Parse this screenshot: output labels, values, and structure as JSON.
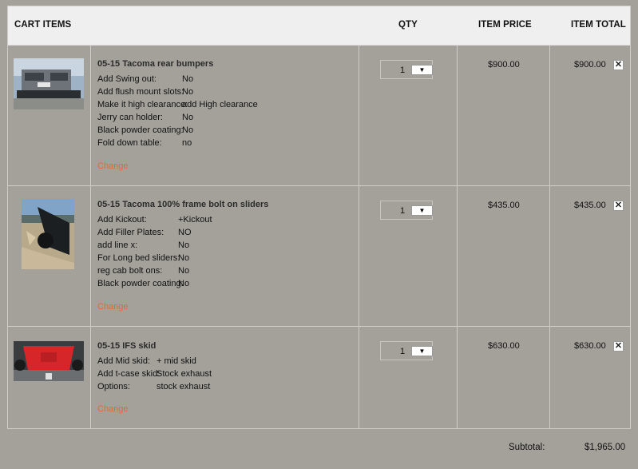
{
  "header": {
    "items_label": "CART ITEMS",
    "qty_label": "QTY",
    "price_label": "ITEM PRICE",
    "total_label": "ITEM TOTAL"
  },
  "items": [
    {
      "name": "05-15 Tacoma rear bumpers",
      "options": [
        {
          "key": "Add Swing out:",
          "value": "No"
        },
        {
          "key": "Add flush mount slots:",
          "value": "No"
        },
        {
          "key": "Make it high clearance:",
          "value": "add High clearance"
        },
        {
          "key": "Jerry can holder:",
          "value": "No"
        },
        {
          "key": "Black powder coating:",
          "value": "No"
        },
        {
          "key": "Fold down table:",
          "value": "no"
        }
      ],
      "change": "Change",
      "qty": "1",
      "price": "$900.00",
      "total": "$900.00"
    },
    {
      "name": "05-15 Tacoma 100% frame bolt on sliders",
      "options": [
        {
          "key": "Add Kickout:",
          "value": "+Kickout"
        },
        {
          "key": "Add Filler Plates:",
          "value": "NO"
        },
        {
          "key": "add line x:",
          "value": "No"
        },
        {
          "key": "For Long bed sliders:",
          "value": "No"
        },
        {
          "key": "reg cab bolt ons:",
          "value": "No"
        },
        {
          "key": "Black powder coating:",
          "value": "No"
        }
      ],
      "change": "Change",
      "qty": "1",
      "price": "$435.00",
      "total": "$435.00"
    },
    {
      "name": "05-15 IFS skid",
      "options": [
        {
          "key": "Add Mid skid:",
          "value": "+ mid skid"
        },
        {
          "key": "Add t-case skid:",
          "value": "Stock exhaust"
        },
        {
          "key": "Options:",
          "value": "stock exhaust"
        }
      ],
      "change": "Change",
      "qty": "1",
      "price": "$630.00",
      "total": "$630.00"
    }
  ],
  "icons": {
    "dropdown": "chevron-down-icon",
    "remove": "close-icon"
  },
  "symbols": {
    "dropdown_glyph": "▼",
    "remove_glyph": "✕"
  },
  "summary": {
    "subtotal_label": "Subtotal:",
    "subtotal_value": "$1,965.00"
  },
  "colors": {
    "background": "#a4a19b",
    "header": "#efefef",
    "change_link": "#e8653a"
  }
}
